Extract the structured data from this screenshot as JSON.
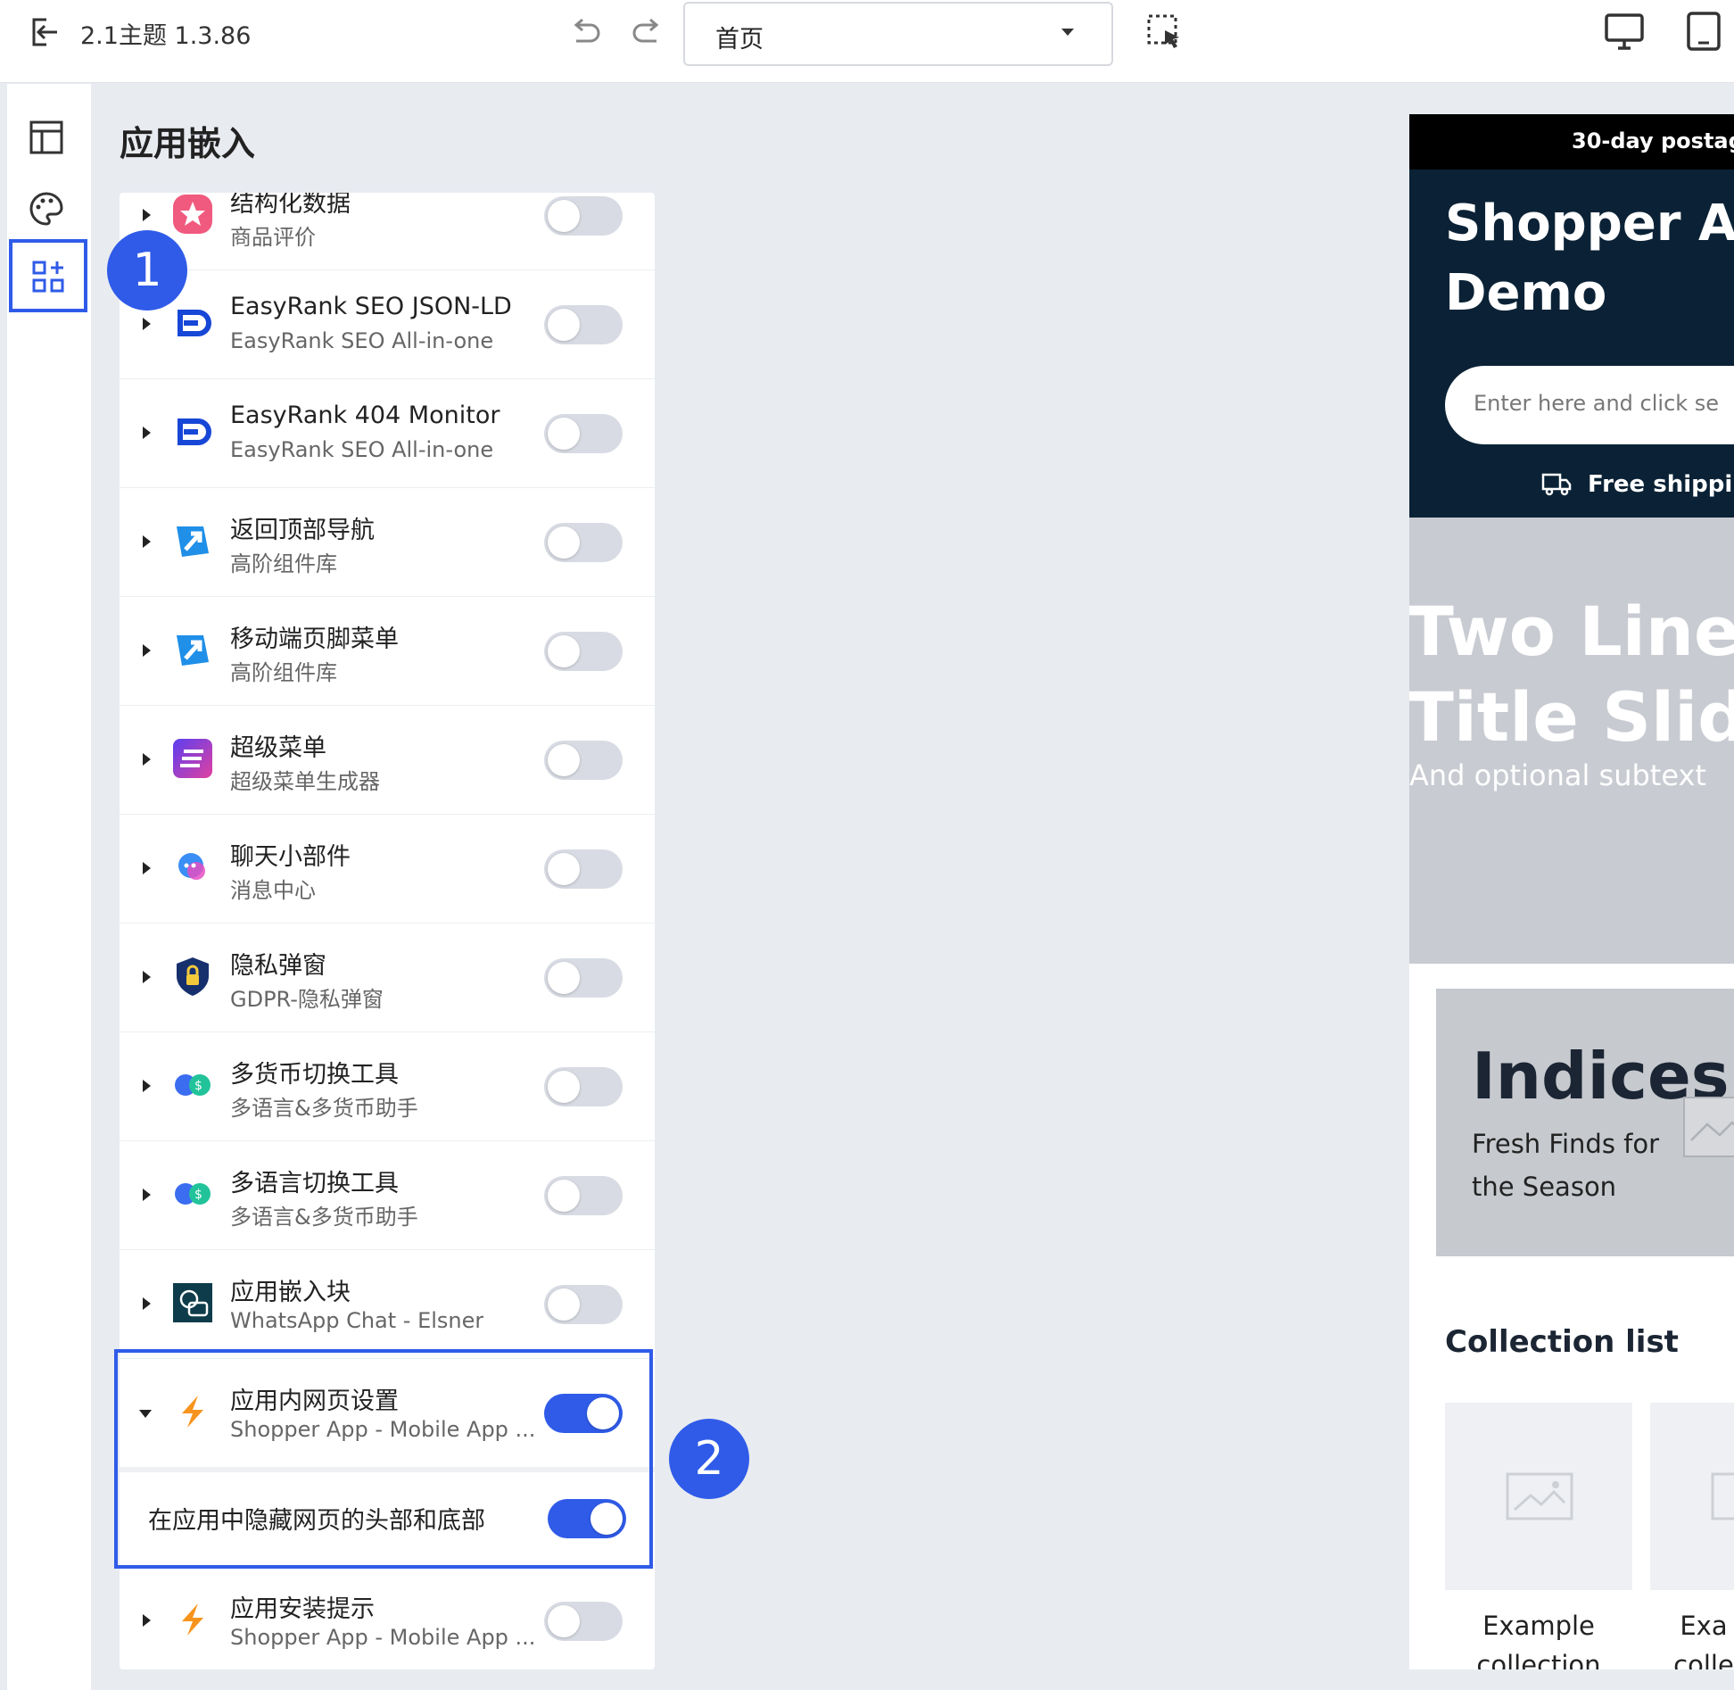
{
  "topbar": {
    "title": "2.1主题 1.3.86",
    "page_select": "首页"
  },
  "panel": {
    "title": "应用嵌入"
  },
  "apps": [
    {
      "title": "结构化数据",
      "sub": "商品评价",
      "on": false
    },
    {
      "title": "EasyRank SEO JSON-LD",
      "sub": "EasyRank SEO All-in-one",
      "on": false
    },
    {
      "title": "EasyRank 404 Monitor",
      "sub": "EasyRank SEO All-in-one",
      "on": false
    },
    {
      "title": "返回顶部导航",
      "sub": "高阶组件库",
      "on": false
    },
    {
      "title": "移动端页脚菜单",
      "sub": "高阶组件库",
      "on": false
    },
    {
      "title": "超级菜单",
      "sub": "超级菜单生成器",
      "on": false
    },
    {
      "title": "聊天小部件",
      "sub": "消息中心",
      "on": false
    },
    {
      "title": "隐私弹窗",
      "sub": "GDPR-隐私弹窗",
      "on": false
    },
    {
      "title": "多货币切换工具",
      "sub": "多语言&多货币助手",
      "on": false
    },
    {
      "title": "多语言切换工具",
      "sub": "多语言&多货币助手",
      "on": false
    },
    {
      "title": "应用嵌入块",
      "sub": "WhatsApp Chat - Elsner",
      "on": false
    },
    {
      "title": "应用内网页设置",
      "sub": "Shopper App - Mobile App ...",
      "on": true
    },
    {
      "title": "应用安装提示",
      "sub": "Shopper App - Mobile App ...",
      "on": false
    }
  ],
  "sub_setting": {
    "label": "在应用中隐藏网页的头部和底部",
    "on": true
  },
  "badges": {
    "one": "1",
    "two": "2"
  },
  "preview": {
    "announcement": "30-day postag",
    "store_title": "Shopper A Demo",
    "search_placeholder": "Enter here and click se",
    "shipping": "Free shippi",
    "slide_title_1": "Two Line",
    "slide_title_2": "Title Slide",
    "slide_sub": "And optional subtext",
    "indices_title": "Indices",
    "indices_sub": "Fresh Finds for the Season",
    "collection_title": "Collection list",
    "card1_label": "Example collection",
    "card2_label": "Exa colle"
  },
  "colors": {
    "accent": "#2f5be8",
    "dark": "#0b2236"
  }
}
